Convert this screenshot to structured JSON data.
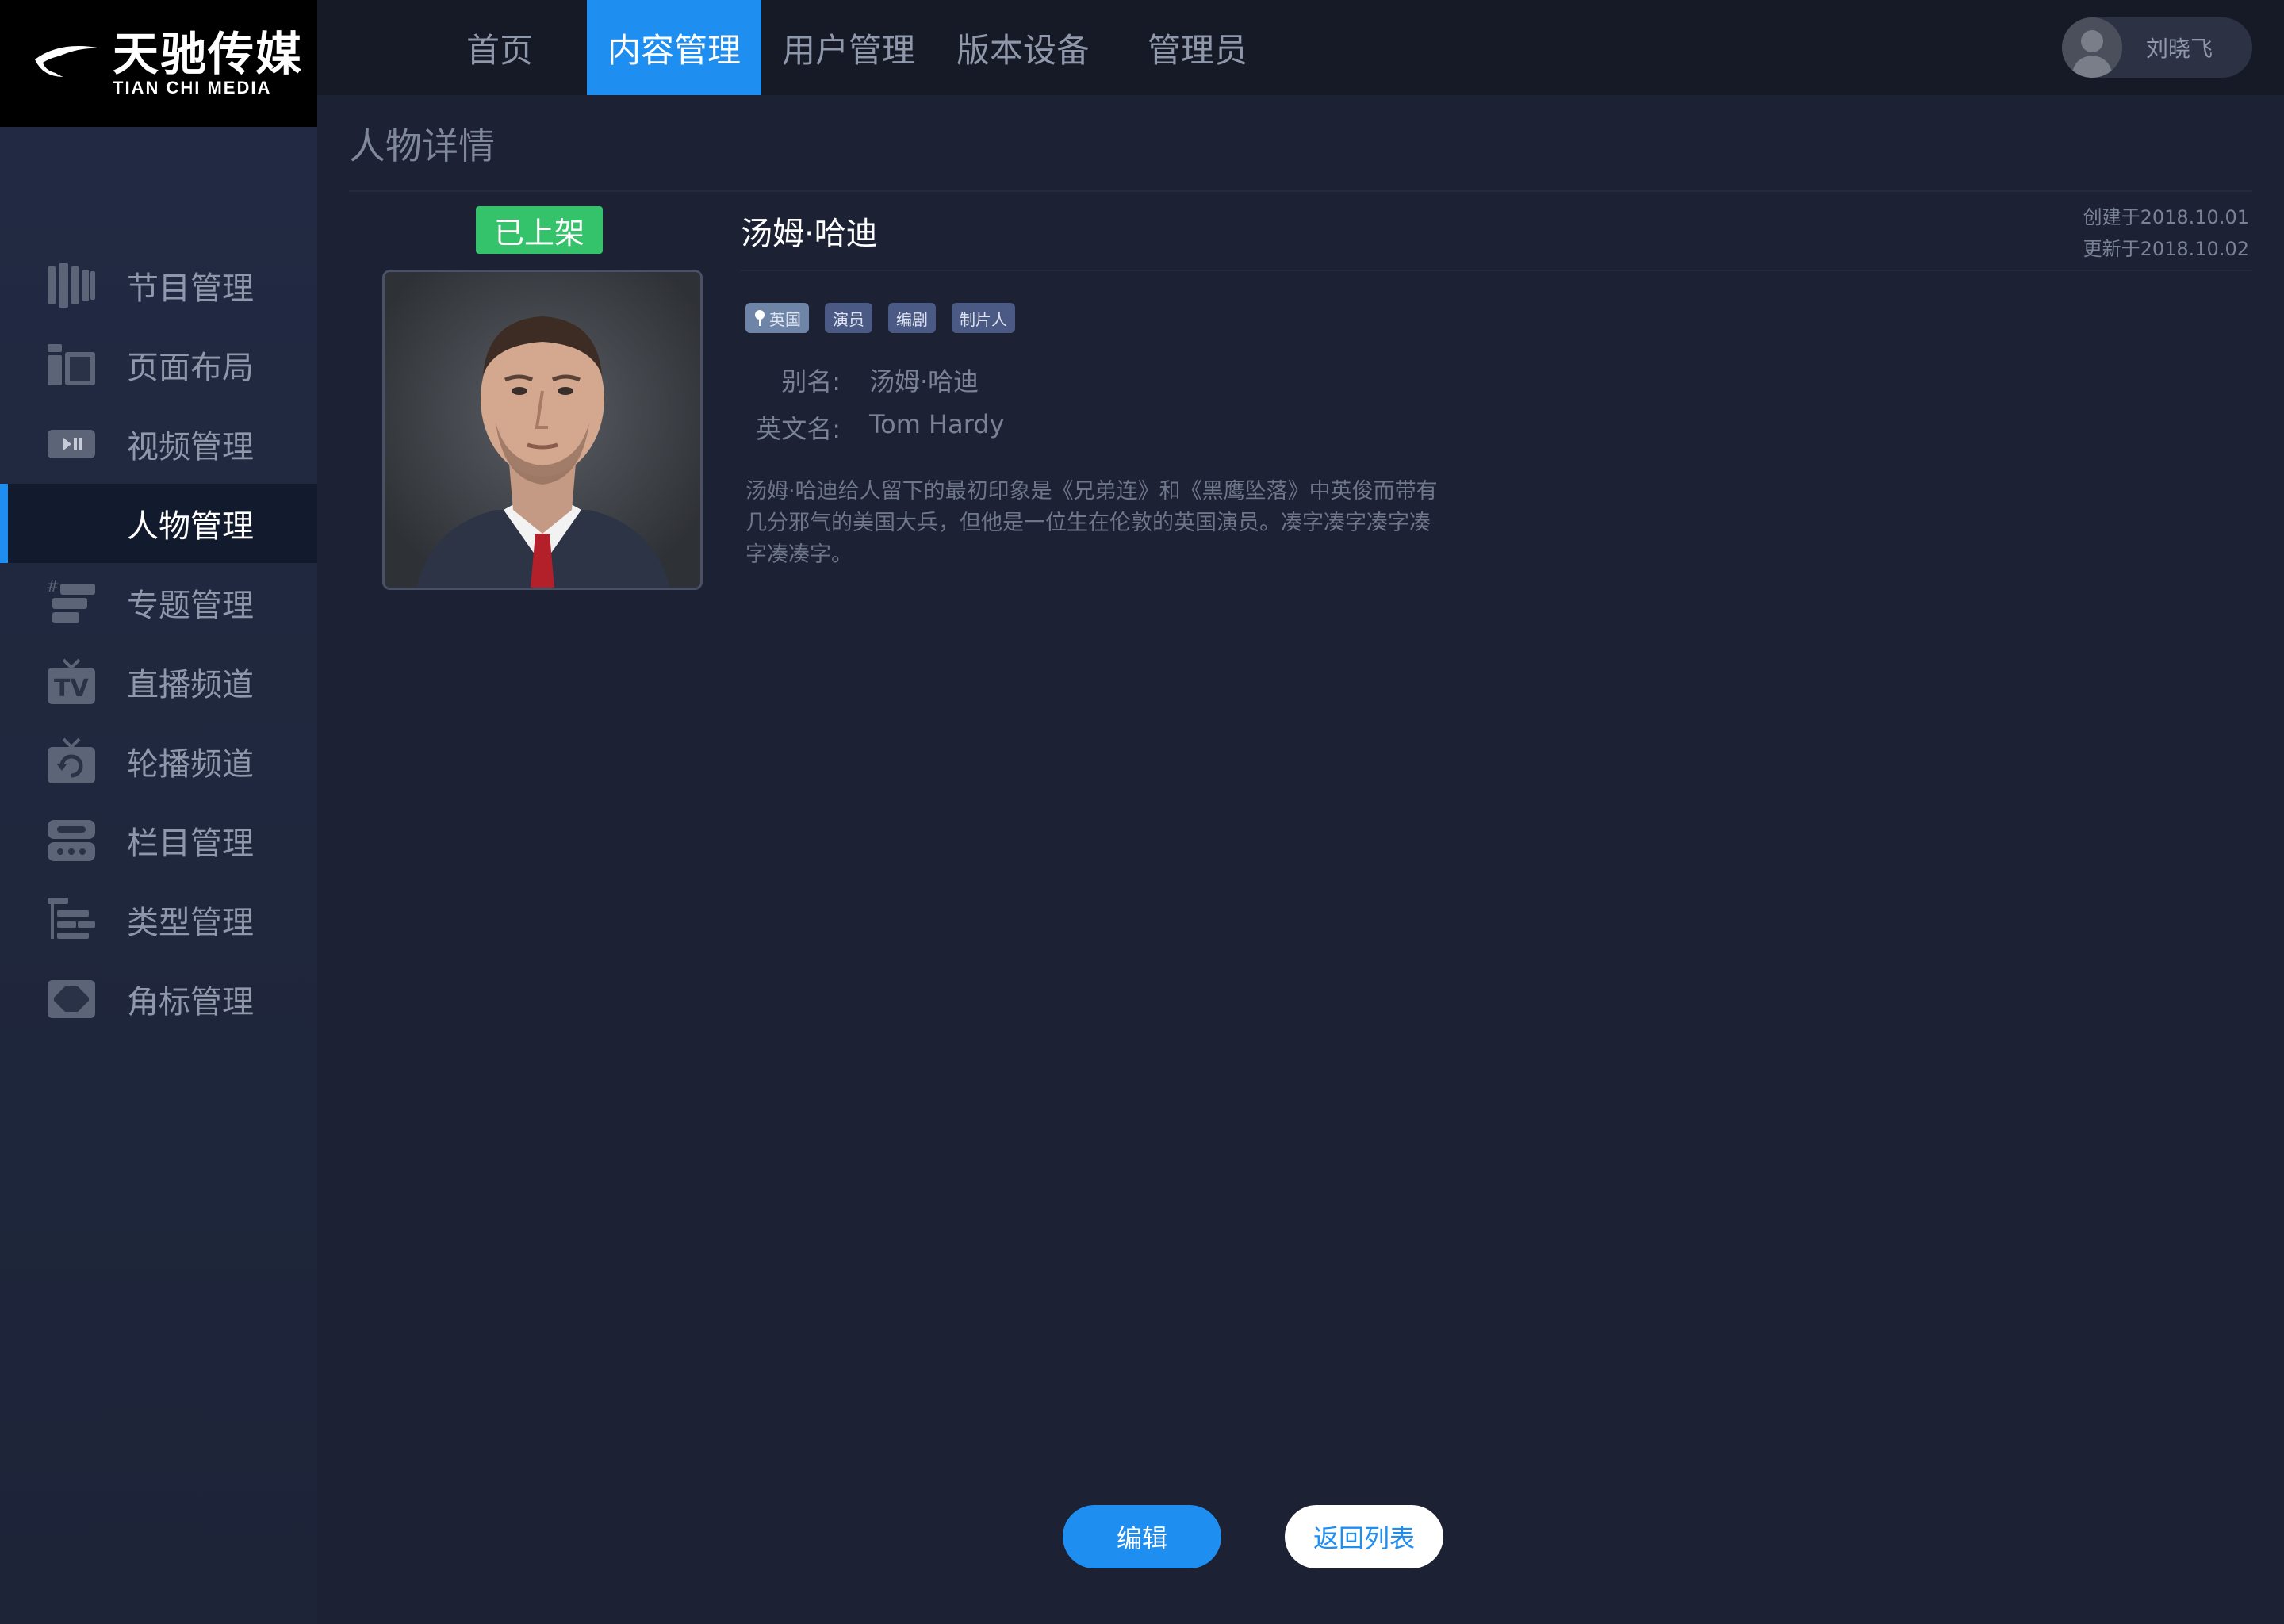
{
  "brand": {
    "name_cn": "天驰传媒",
    "name_en": "TIAN CHI MEDIA"
  },
  "topnav": {
    "items": [
      {
        "label": "首页",
        "active": false
      },
      {
        "label": "内容管理",
        "active": true
      },
      {
        "label": "用户管理",
        "active": false
      },
      {
        "label": "版本设备",
        "active": false
      },
      {
        "label": "管理员",
        "active": false
      }
    ],
    "user": {
      "name": "刘晓飞"
    }
  },
  "sidebar": {
    "items": [
      {
        "label": "节目管理",
        "icon": "film-strip-icon",
        "active": false
      },
      {
        "label": "页面布局",
        "icon": "layout-icon",
        "active": false
      },
      {
        "label": "视频管理",
        "icon": "video-play-icon",
        "active": false
      },
      {
        "label": "人物管理",
        "icon": "person-icon",
        "active": true
      },
      {
        "label": "专题管理",
        "icon": "topic-icon",
        "active": false
      },
      {
        "label": "直播频道",
        "icon": "tv-icon",
        "active": false
      },
      {
        "label": "轮播频道",
        "icon": "carousel-tv-icon",
        "active": false
      },
      {
        "label": "栏目管理",
        "icon": "column-icon",
        "active": false
      },
      {
        "label": "类型管理",
        "icon": "category-tree-icon",
        "active": false
      },
      {
        "label": "角标管理",
        "icon": "corner-badge-icon",
        "active": false
      }
    ]
  },
  "page": {
    "title": "人物详情",
    "status": "已上架",
    "person": {
      "name": "汤姆·哈迪",
      "created": "创建于2018.10.01",
      "updated": "更新于2018.10.02",
      "tags": [
        {
          "label": "英国",
          "type": "country"
        },
        {
          "label": "演员",
          "type": "role"
        },
        {
          "label": "编剧",
          "type": "role"
        },
        {
          "label": "制片人",
          "type": "role"
        }
      ],
      "alias_label": "别名:",
      "alias_value": "汤姆·哈迪",
      "english_label": "英文名:",
      "english_value": "Tom Hardy",
      "bio_lines": [
        "汤姆·哈迪给人留下的最初印象是《兄弟连》和《黑鹰坠落》中英俊而带有",
        "几分邪气的美国大兵，但他是一位生在伦敦的英国演员。凑字凑字凑字凑",
        "字凑凑字。"
      ]
    }
  },
  "actions": {
    "edit_label": "编辑",
    "back_label": "返回列表"
  },
  "colors": {
    "accent": "#1f8ef1",
    "status_green": "#34c36a",
    "background": "#1c2134",
    "topbar": "#151a26"
  }
}
